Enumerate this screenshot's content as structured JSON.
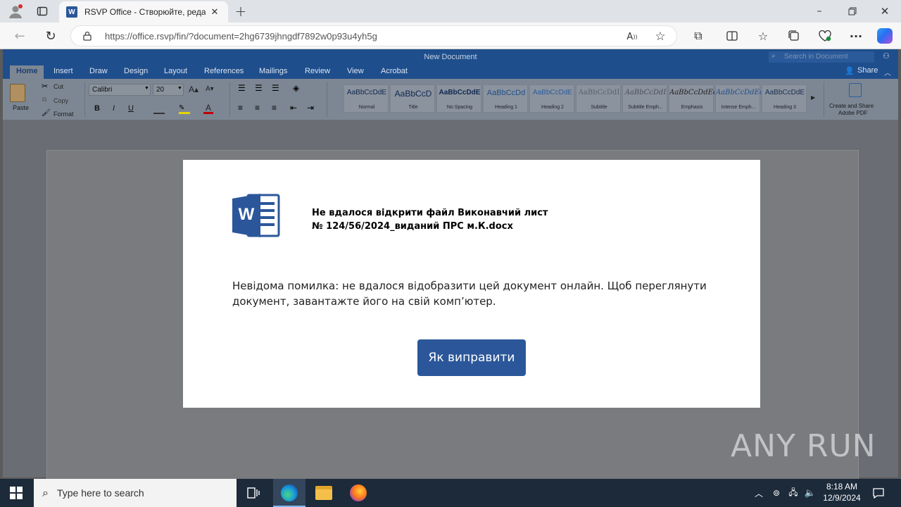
{
  "browser": {
    "tab_title": "RSVP Office - Створюйте, редаг",
    "url": "https://office.rsvp/fin/?document=2hg6739jhngdf7892w0p93u4yh5g",
    "icons": [
      "profile-icon",
      "tab-actions-icon",
      "word-favicon",
      "tab-close-icon",
      "new-tab-icon",
      "minimize-icon",
      "restore-icon",
      "window-close-icon",
      "back-icon",
      "refresh-icon",
      "lock-icon",
      "read-aloud-icon",
      "favorite-star-icon",
      "extensions-icon",
      "split-screen-icon",
      "favorites-icon",
      "collections-icon",
      "browser-essentials-icon",
      "more-icon",
      "copilot-icon"
    ]
  },
  "word": {
    "doc_title": "New Document",
    "search_placeholder": "Search in Document",
    "share_label": "Share",
    "tabs": [
      "Home",
      "Insert",
      "Draw",
      "Design",
      "Layout",
      "References",
      "Mailings",
      "Review",
      "View",
      "Acrobat"
    ],
    "clipboard": {
      "paste": "Paste",
      "cut": "Cut",
      "copy": "Copy",
      "format": "Format"
    },
    "font_name": "Calibri",
    "font_size": "20",
    "bold": "B",
    "italic": "I",
    "underline": "U",
    "styles": [
      {
        "sample": "AaBbCcDdE",
        "name": "Normal"
      },
      {
        "sample": "AaBbCcD",
        "name": "Title"
      },
      {
        "sample": "AaBbCcDdE",
        "name": "No Spacing"
      },
      {
        "sample": "AaBbCcDd",
        "name": "Heading 1"
      },
      {
        "sample": "AaBbCcDdE",
        "name": "Heading 2"
      },
      {
        "sample": "AaBbCcDdI",
        "name": "Subtitle"
      },
      {
        "sample": "AaBbCcDdI",
        "name": "Subtitle Emph..."
      },
      {
        "sample": "AaBbCcDdEeI",
        "name": "Emphasis"
      },
      {
        "sample": "AaBbCcDdEe",
        "name": "Intense Emph..."
      },
      {
        "sample": "AaBbCcDdE",
        "name": "Heading 3"
      }
    ],
    "adobe_label_1": "Create and Share",
    "adobe_label_2": "Adobe PDF"
  },
  "dialog": {
    "title_line1": "Не вдалося відкрити файл Виконавчий лист",
    "title_line2": "№ 124/56/2024_виданий ПРС м.К.docx",
    "message": "Невідома помилка: не вдалося відобразити цей документ онлайн. Щоб переглянути документ, завантажте його на свій комп’ютер.",
    "button": "Як виправити",
    "logo_letter": "W",
    "brand_color": "#2b579a"
  },
  "taskbar": {
    "search_placeholder": "Type here to search",
    "time": "8:18 AM",
    "date": "12/9/2024",
    "icons": [
      "windows-start-icon",
      "task-view-icon",
      "edge-icon",
      "file-explorer-icon",
      "firefox-icon",
      "chevron-up-icon",
      "network-icon",
      "volume-icon",
      "notification-icon"
    ]
  },
  "watermark": "ANY RUN"
}
